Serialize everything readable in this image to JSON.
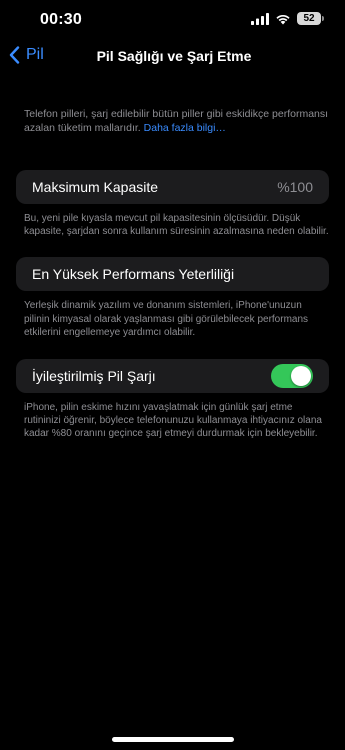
{
  "status_bar": {
    "time": "00:30",
    "battery_level": "52",
    "icons": [
      "cellular-signal-icon",
      "wifi-icon",
      "battery-icon"
    ]
  },
  "nav": {
    "back_label": "Pil",
    "title": "Pil Sağlığı ve Şarj Etme"
  },
  "intro": {
    "text": "Telefon pilleri, şarj edilebilir bütün piller gibi eskidikçe performansı azalan tüketim mallarıdır.",
    "link": "Daha fazla bilgi…"
  },
  "maximum_capacity": {
    "label": "Maksimum Kapasite",
    "value": "%100",
    "description": "Bu, yeni pile kıyasla mevcut pil kapasitesinin ölçüsüdür. Düşük kapasite, şarjdan sonra kullanım süresinin azalmasına neden olabilir."
  },
  "peak_performance": {
    "label": "En Yüksek Performans Yeterliliği",
    "description": "Yerleşik dinamik yazılım ve donanım sistemleri, iPhone'unuzun pilinin kimyasal olarak yaşlanması gibi görülebilecek performans etkilerini engellemeye yardımcı olabilir."
  },
  "optimized_charging": {
    "label": "İyileştirilmiş Pil Şarjı",
    "enabled": true,
    "description": "iPhone, pilin eskime hızını yavaşlatmak için günlük şarj etme rutininizi öğrenir, böylece telefonunuzu kullanmaya ihtiyacınız olana kadar %80 oranını geçince şarj etmeyi durdurmak için bekleyebilir."
  },
  "colors": {
    "background": "#000000",
    "card": "#1c1c1e",
    "accent": "#3a8cff",
    "toggle_on": "#34c759",
    "secondary_text": "#8e8e93"
  }
}
